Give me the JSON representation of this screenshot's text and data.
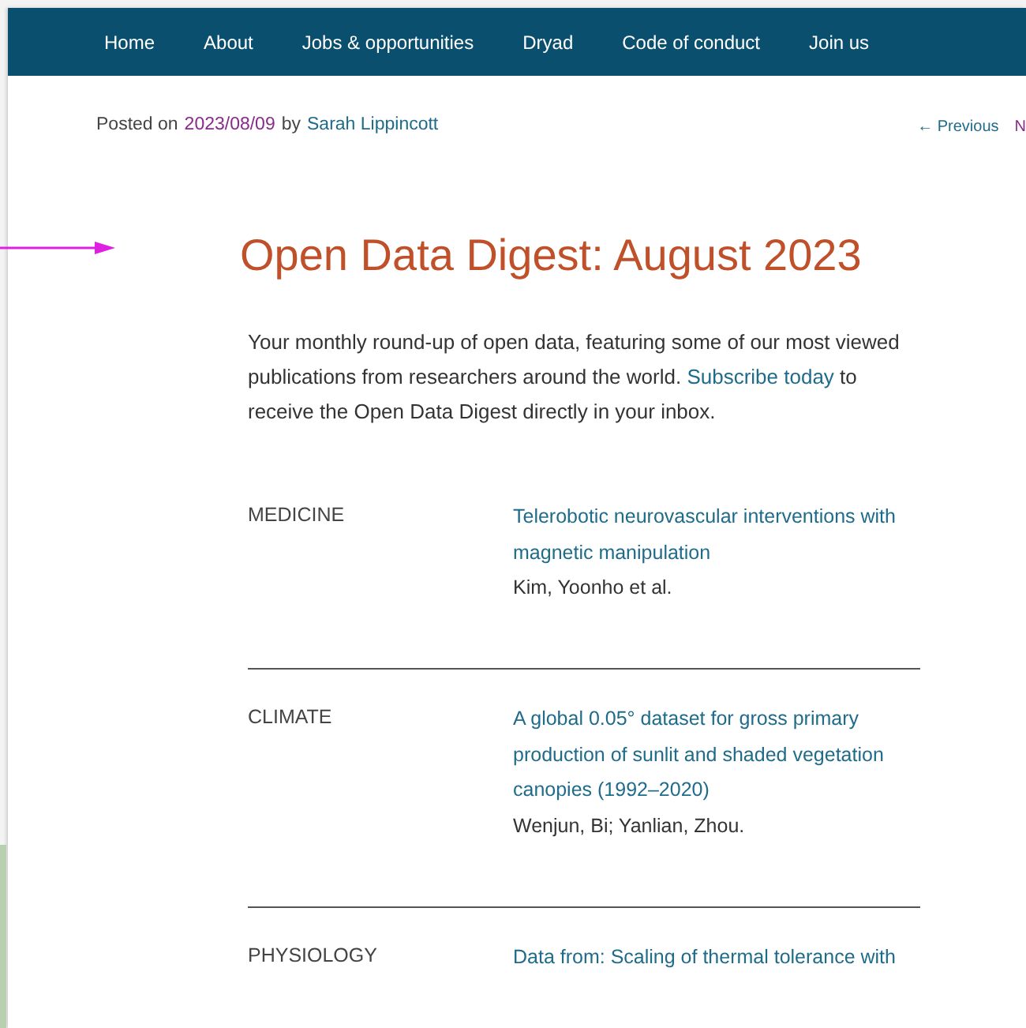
{
  "nav": {
    "items": [
      {
        "label": "Home"
      },
      {
        "label": "About"
      },
      {
        "label": "Jobs & opportunities"
      },
      {
        "label": "Dryad"
      },
      {
        "label": "Code of conduct"
      },
      {
        "label": "Join us"
      }
    ]
  },
  "post_meta": {
    "prefix": "Posted on",
    "date": "2023/08/09",
    "by": "by",
    "author": "Sarah Lippincott"
  },
  "post_nav": {
    "previous": "← Previous",
    "next": "N"
  },
  "article": {
    "title": "Open Data Digest: August 2023",
    "intro_before": "Your monthly round-up of open data, featuring some of our most viewed publications from researchers around the world.",
    "intro_link": "Subscribe today",
    "intro_after": "to receive the Open Data Digest directly in your inbox.",
    "entries": [
      {
        "category": "MEDICINE",
        "title": "Telerobotic neurovascular interventions with magnetic manipulation",
        "authors": "Kim, Yoonho et al."
      },
      {
        "category": "CLIMATE",
        "title": "A global 0.05° dataset for gross primary production of sunlit and shaded vegetation canopies (1992–2020)",
        "authors": "Wenjun, Bi; Yanlian, Zhou."
      },
      {
        "category": "PHYSIOLOGY",
        "title": "Data from: Scaling of thermal tolerance with"
      }
    ]
  }
}
